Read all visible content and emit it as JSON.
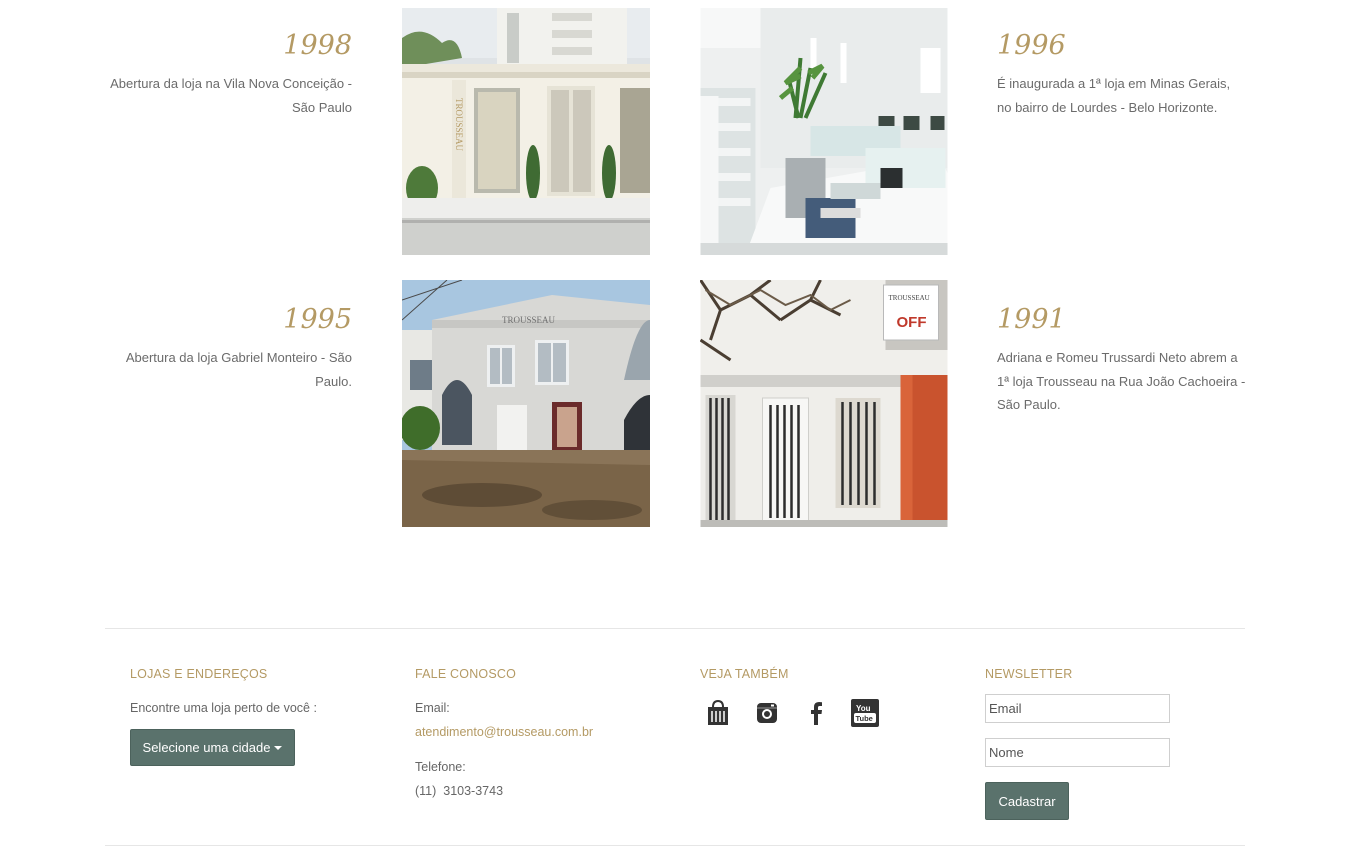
{
  "timeline": [
    {
      "year": "1998",
      "desc_line1": "Abertura da loja na Vila Nova Conceição -",
      "desc_line2": "São Paulo",
      "photo": "storefront-vila-nova-photo"
    },
    {
      "year": "1996",
      "desc_line1": "É inaugurada a 1ª loja em Minas Gerais,",
      "desc_line2": "no bairro de Lourdes - Belo Horizonte.",
      "photo": "store-interior-photo"
    },
    {
      "year": "1995",
      "desc_line1": "Abertura da loja Gabriel Monteiro - São",
      "desc_line2": "Paulo.",
      "photo": "gabriel-monteiro-building-photo"
    },
    {
      "year": "1991",
      "desc_line1": "Adriana e Romeu Trussardi Neto abrem a",
      "desc_line2": "1ª loja Trousseau na Rua João Cachoeira -",
      "desc_line3": "São Paulo.",
      "photo": "first-store-photo"
    }
  ],
  "photo_labels": {
    "sign_vertical": "TROUSSEAU",
    "sign_off": "OFF",
    "sign_trousseau": "TROUSSEAU"
  },
  "footer": {
    "stores": {
      "heading": "LOJAS E ENDEREÇOS",
      "text": "Encontre uma loja perto de você :",
      "button": "Selecione uma cidade"
    },
    "contact": {
      "heading": "FALE CONOSCO",
      "email_label": "Email:",
      "email": "atendimento@trousseau.com.br",
      "phone_label": "Telefone:",
      "phone": "(11)  3103-3743"
    },
    "see_also": {
      "heading": "VEJA TAMBÉM",
      "icons": [
        "shopping-bag-icon",
        "instagram-icon",
        "facebook-icon",
        "youtube-icon"
      ],
      "youtube_you": "You",
      "youtube_tube": "Tube"
    },
    "newsletter": {
      "heading": "NEWSLETTER",
      "email_placeholder": "Email",
      "name_placeholder": "Nome",
      "button": "Cadastrar"
    }
  },
  "colors": {
    "accent_gold": "#b49a64",
    "button_green": "#5a726c"
  }
}
